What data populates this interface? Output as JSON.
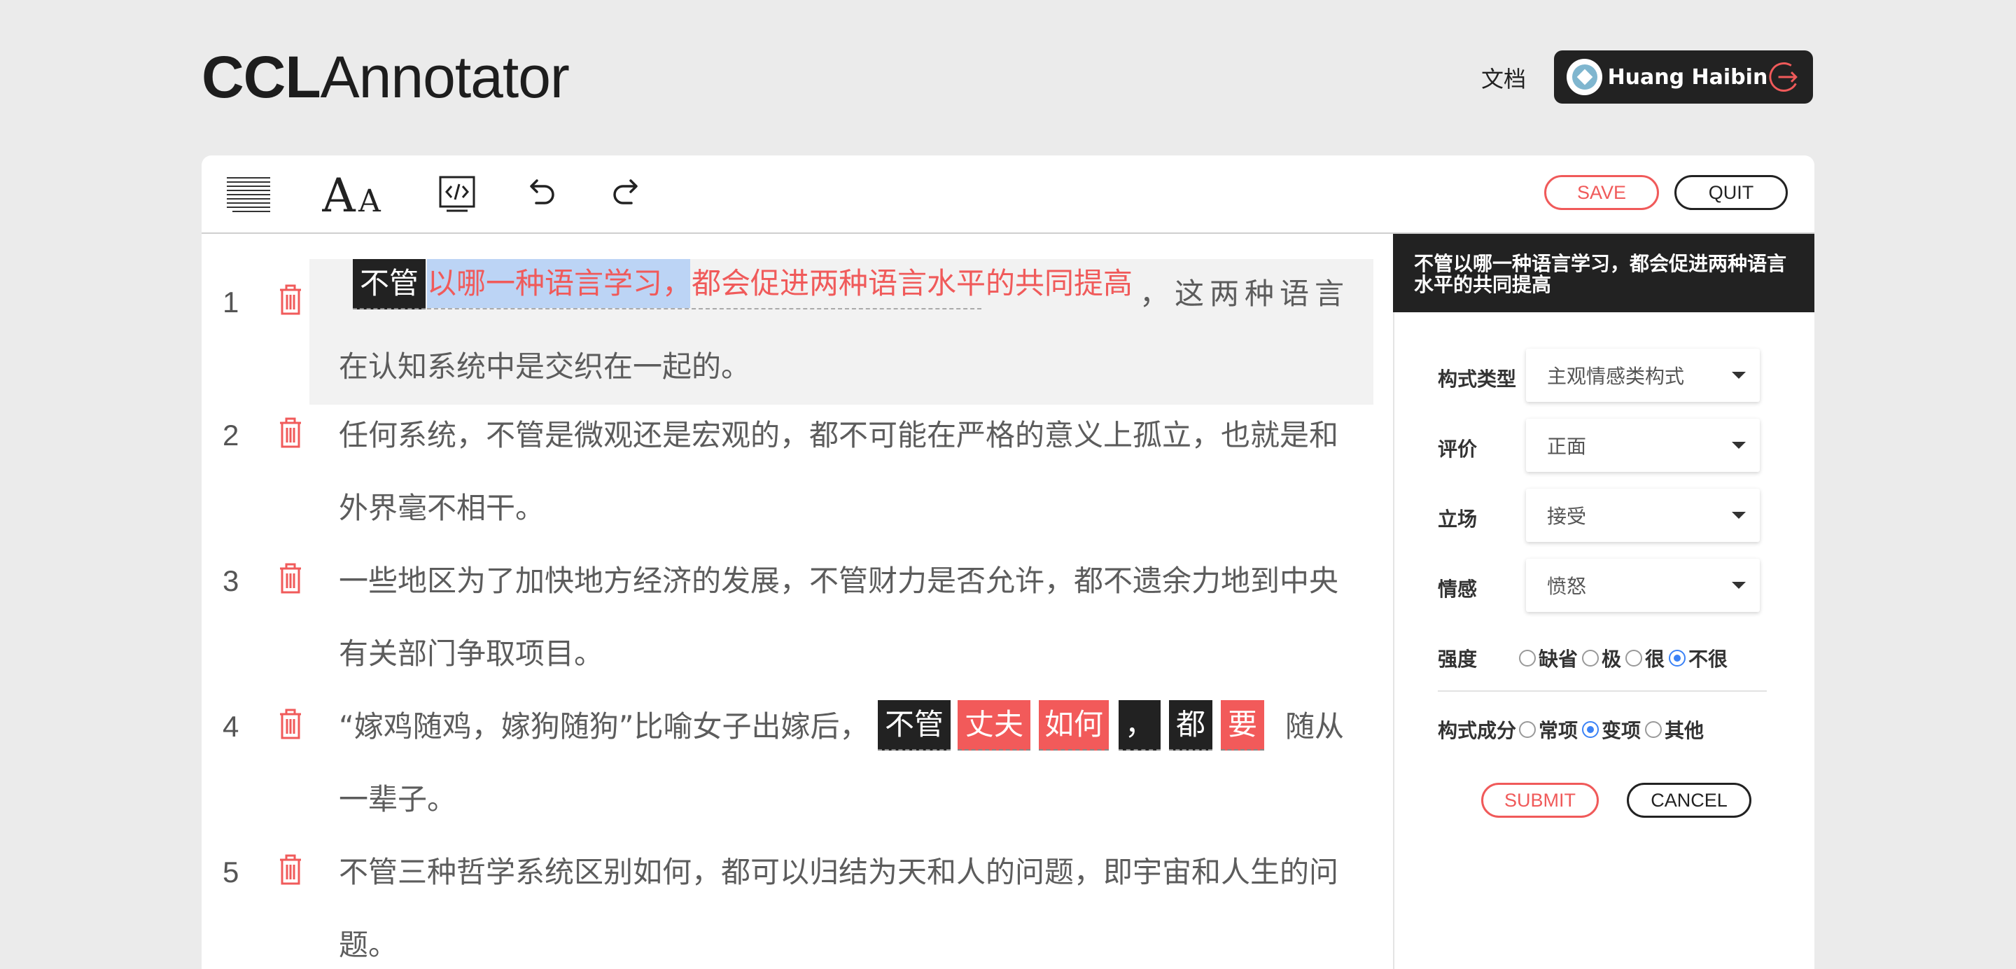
{
  "header": {
    "logo_bold": "CCL",
    "logo_light": "Annotator",
    "docs_link": "文档",
    "user_name": "Huang Haibin"
  },
  "toolbar": {
    "save_label": "SAVE",
    "quit_label": "QUIT"
  },
  "rows": [
    {
      "num": "1",
      "chip": "不管",
      "selected_blue": "以哪一种语言学习，",
      "selected_rest": "都会促进两种语言水平的共同提高",
      "after": "，这两种语言",
      "line2": "在认知系统中是交织在一起的。"
    },
    {
      "num": "2",
      "line1": "任何系统，不管是微观还是宏观的，都不可能在严格的意义上孤立，也就是和",
      "line2": "外界毫不相干。"
    },
    {
      "num": "3",
      "line1": "一些地区为了加快地方经济的发展，不管财力是否允许，都不遗余力地到中央",
      "line2": "有关部门争取项目。"
    },
    {
      "num": "4",
      "line1": "“嫁鸡随鸡，嫁狗随狗”比喻女子出嫁后，",
      "chips": [
        "不管",
        "丈夫",
        "如何",
        "，",
        "都",
        "要"
      ],
      "after": "随从",
      "line2": "一辈子。"
    },
    {
      "num": "5",
      "line1": "不管三种哲学系统区别如何，都可以归结为天和人的问题，即宇宙和人生的问",
      "line2": "题。"
    }
  ],
  "sidebar": {
    "title": "不管以哪一种语言学习，都会促进两种语言水平的共同提高",
    "fields": [
      {
        "label": "构式类型",
        "value": "主观情感类构式"
      },
      {
        "label": "评价",
        "value": "正面"
      },
      {
        "label": "立场",
        "value": "接受"
      },
      {
        "label": "情感",
        "value": "愤怒"
      }
    ],
    "intensity": {
      "label": "强度",
      "options": [
        "缺省",
        "极",
        "很",
        "不很"
      ],
      "selected": "不很"
    },
    "component": {
      "label": "构式成分",
      "options": [
        "常项",
        "变项",
        "其他"
      ],
      "selected": "变项"
    },
    "submit_label": "SUBMIT",
    "cancel_label": "CANCEL"
  },
  "colors": {
    "accent_red": "#f05a5a",
    "dark": "#222222",
    "selection_blue": "#bcd4f5",
    "radio_blue": "#3b82f6"
  }
}
